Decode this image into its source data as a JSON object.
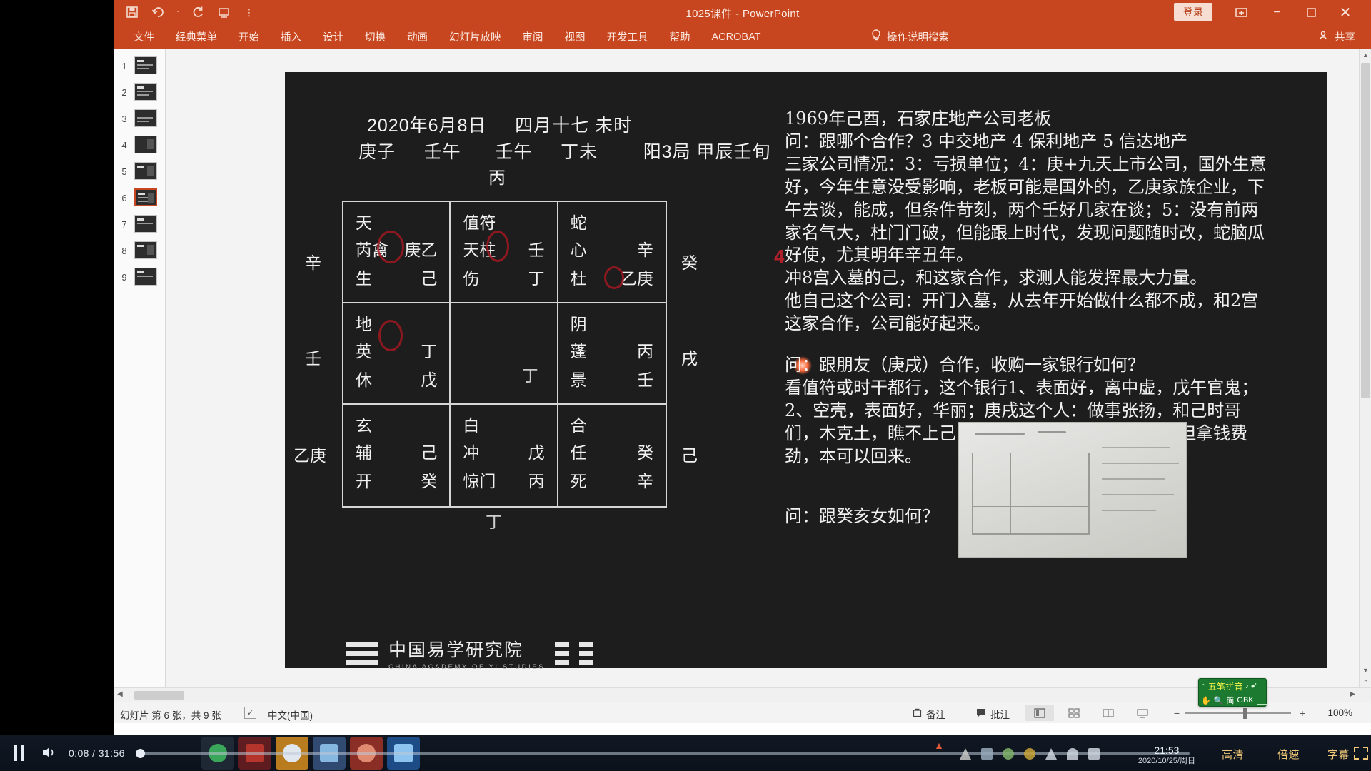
{
  "window": {
    "title": "1025课件  -  PowerPoint",
    "login_label": "登录",
    "restore_icon": "restore-down-icon",
    "minimize_icon": "minimize-icon",
    "maximize_icon": "maximize-icon",
    "close_icon": "close-icon"
  },
  "quick_access": [
    {
      "name": "save-icon",
      "glyph": "⬚"
    },
    {
      "name": "undo-icon",
      "glyph": "↶"
    },
    {
      "name": "redo-icon",
      "glyph": "↻"
    },
    {
      "name": "start-slideshow-icon",
      "glyph": "▤"
    },
    {
      "name": "customize-quick-access-icon",
      "glyph": "⋮"
    }
  ],
  "ribbon": {
    "tabs": [
      "文件",
      "经典菜单",
      "开始",
      "插入",
      "设计",
      "切换",
      "动画",
      "幻灯片放映",
      "审阅",
      "视图",
      "开发工具",
      "帮助",
      "ACROBAT"
    ],
    "tell_me": "操作说明搜索",
    "share": "共享"
  },
  "thumbnails": {
    "slides": [
      1,
      2,
      3,
      4,
      5,
      6,
      7,
      8,
      9
    ],
    "selected": 6
  },
  "slide": {
    "date_line": "2020年6月8日     四月十七 未时",
    "pillar_line": "庚子     壬午      壬午     丁未        阳3局 甲辰壬旬",
    "center_top": "丙",
    "grid": [
      {
        "deity": "天",
        "star": "芮禽",
        "stem_top": "庚乙",
        "gate": "生",
        "stem_bottom": "己"
      },
      {
        "deity": "值符",
        "star": "天柱",
        "stem_top": "壬",
        "gate": "伤",
        "stem_bottom": "丁"
      },
      {
        "deity": "蛇",
        "star": "心",
        "stem_top": "辛",
        "gate": "杜",
        "stem_bottom": "乙庚"
      },
      {
        "deity": "地",
        "star": "英",
        "stem_top": "丁",
        "gate": "休",
        "stem_bottom": "戊"
      },
      {
        "deity": "",
        "star": "",
        "stem_top": "",
        "gate": "",
        "stem_bottom": "",
        "center": "丁"
      },
      {
        "deity": "阴",
        "star": "蓬",
        "stem_top": "丙",
        "gate": "景",
        "stem_bottom": "壬"
      },
      {
        "deity": "玄",
        "star": "辅",
        "stem_top": "己",
        "gate": "开",
        "stem_bottom": "癸"
      },
      {
        "deity": "白",
        "star": "冲",
        "stem_top": "戊",
        "gate": "惊门",
        "stem_bottom": "丙"
      },
      {
        "deity": "合",
        "star": "任",
        "stem_top": "癸",
        "gate": "死",
        "stem_bottom": "辛"
      }
    ],
    "left_labels": [
      "辛",
      "壬",
      "乙庚"
    ],
    "right_labels": [
      "癸",
      "戌",
      "己"
    ],
    "bottom_label": "丁",
    "ink_annotation": "4",
    "right_text": [
      "1969年己酉，石家庄地产公司老板",
      "问：跟哪个合作？3 中交地产 4 保利地产 5 信达地产",
      "三家公司情况：3：亏损单位；4：庚+九天上市公司，国外生意好，今年生意没受影响，老板可能是国外的，乙庚家族企业，下午去谈，能成，但条件苛刻，两个壬好几家在谈；5：没有前两家名气大，杜门门破，但能跟上时代，发现问题随时改，蛇脑瓜好使，尤其明年辛丑年。",
      "冲8宫入墓的己，和这家合作，求测人能发挥最大力量。",
      "他自己这个公司：开门入墓，从去年开始做什么都不成，和2宫这家合作，公司能好起来。"
    ],
    "right_text_2": [
      "问：跟朋友（庚戌）合作，收购一家银行如何？",
      "看值符或时干都行，这个银行1、表面好，离中虚，戊午官鬼；2、空壳，表面好，华丽；庚戌这个人：做事张扬，和己时哥们，木克土，瞧不上己，关系没那么铁；收购可成，但拿钱费劲，本可以回来。"
    ],
    "right_text_3": "问：跟癸亥女如何？",
    "logo_cn": "中国易学研究院",
    "logo_en": "CHINA ACADEMY OF YI STUDIES"
  },
  "status_bar": {
    "slide_count": "幻灯片 第 6 张，共 9 张",
    "spell_check_icon": "spell-check-icon",
    "language": "中文(中国)",
    "notes": "备注",
    "comments": "批注",
    "view_normal_icon": "normal-view-icon",
    "view_sorter_icon": "slide-sorter-icon",
    "view_reading_icon": "reading-view-icon",
    "view_show_icon": "slideshow-view-icon",
    "zoom_out": "−",
    "zoom_in": "+",
    "zoom_level": "100%"
  },
  "ime": {
    "name": "五笔拼音",
    "caret": "⌃",
    "note": "♪ ●'",
    "hand_icon": "hand-icon",
    "search_icon": "search-icon",
    "mode": "简",
    "charset": "GBK",
    "keyboard_icon": "keyboard-icon"
  },
  "player": {
    "pause_icon": "pause-icon",
    "volume_icon": "volume-icon",
    "time": "0:08 / 31:56",
    "hd_label": "高清",
    "speed_label": "倍速",
    "subtitle_label": "字幕",
    "fullscreen_icon": "fullscreen-icon"
  },
  "taskbar": {
    "clock_time": "21:53",
    "clock_date": "2020/10/25/周日"
  }
}
